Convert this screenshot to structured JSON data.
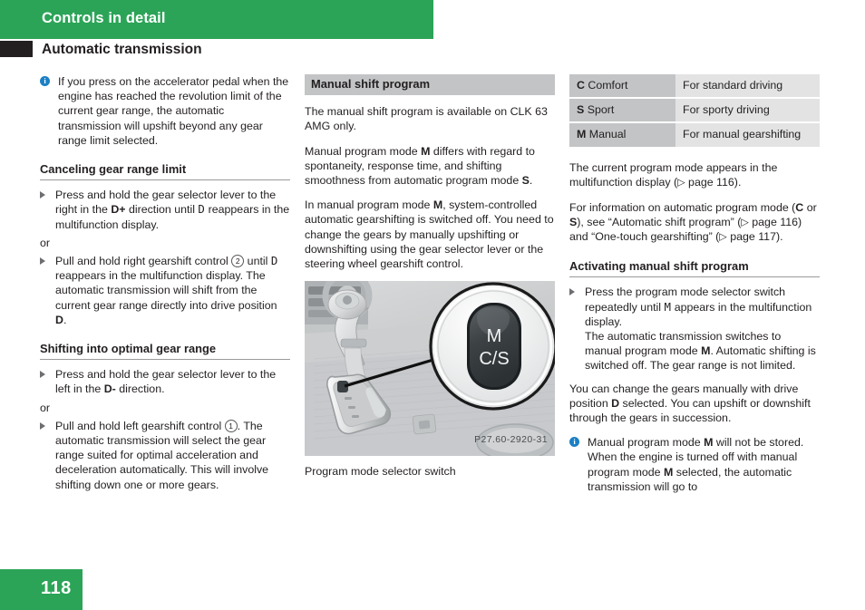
{
  "header": {
    "chapter_title": "Controls in detail",
    "section_title": "Automatic transmission",
    "bar_color": "#2ba457",
    "tab_color": "#231f20"
  },
  "footer": {
    "page_number": "118",
    "block_color": "#2ba457"
  },
  "left_column": {
    "note_icon": "info-icon",
    "note_text": "If you press on the accelerator pedal when the engine has reached the revolution limit of the current gear range, the automatic transmission will upshift beyond any gear range limit selected.",
    "heading_1": "Canceling gear range limit",
    "step_1_a": "Press and hold the gear selector lever to the right in the ",
    "step_1_a_bold": "D+",
    "step_1_a_cont": " direction until ",
    "step_1_a_glyph": "D",
    "step_1_a_end": " reappears in the multifunction display.",
    "or_label": "or",
    "step_1_b_start": "Pull and hold right gearshift control ",
    "step_1_b_callout": "2",
    "step_1_b_mid": " until ",
    "step_1_b_glyph": "D",
    "step_1_b_end": " reappears in the multifunction display. The automatic transmission will shift from the current gear range directly into drive position ",
    "step_1_b_bold": "D",
    "step_1_b_period": ".",
    "heading_2": "Shifting into optimal gear range",
    "step_2_a": "Press and hold the gear selector lever to the left in the ",
    "step_2_a_bold": "D-",
    "step_2_a_end": " direction.",
    "or_label_2": "or",
    "step_2_b_start": "Pull and hold left gearshift control ",
    "step_2_b_callout": "1",
    "step_2_b_end": ". The automatic transmission will select the gear range suited for optimal acceleration and deceleration automatically. This will involve shifting down one or more gears."
  },
  "middle_column": {
    "band_heading": "Manual shift program",
    "para_1": "The manual shift program is available on CLK 63 AMG only.",
    "para_2_a": "Manual program mode ",
    "para_2_bold_1": "M",
    "para_2_b": " differs with regard to spontaneity, response time, and shifting smoothness from automatic program mode ",
    "para_2_bold_2": "S",
    "para_2_c": ".",
    "para_3_a": "In manual program mode ",
    "para_3_bold": "M",
    "para_3_b": ", system-controlled automatic gearshifting is switched off. You need to change the gears by manually upshifting or downshifting using the gear selector lever or the steering wheel gearshift control.",
    "figure_name": "program-mode-selector-switch-photo",
    "figure_button_label_1": "M",
    "figure_button_label_2": "C/S",
    "figure_code": "P27.60-2920-31",
    "figure_caption": "Program mode selector switch"
  },
  "right_column": {
    "table": {
      "rows": [
        {
          "key_bold": "C",
          "key_text": " Comfort",
          "value": "For standard driving"
        },
        {
          "key_bold": "S",
          "key_text": " Sport",
          "value": "For sporty driving"
        },
        {
          "key_bold": "M",
          "key_text": " Manual",
          "value": "For manual gearshifting"
        }
      ]
    },
    "para_1_a": "The current program mode appears in the multifunction display (",
    "para_1_ref": "▷",
    "para_1_b": " page 116).",
    "para_2_a": "For information on automatic program mode (",
    "para_2_bold_1": "C",
    "para_2_b": " or ",
    "para_2_bold_2": "S",
    "para_2_c": "), see “Automatic shift program” (",
    "para_2_ref_1": "▷",
    "para_2_d": " page 116) and “One-touch gearshifting” (",
    "para_2_ref_2": "▷",
    "para_2_e": " page 117).",
    "heading": "Activating manual shift program",
    "step_a": "Press the program mode selector switch repeatedly until ",
    "step_a_glyph": "M",
    "step_a_cont": " appears in the multifunction display.",
    "step_a_line2_a": "The automatic transmission switches to manual program mode ",
    "step_a_bold": "M",
    "step_a_line2_b": ". Automatic shifting is switched off. The gear range is not limited.",
    "para_3_a": "You can change the gears manually with drive position ",
    "para_3_bold": "D",
    "para_3_b": " selected. You can upshift or downshift through the gears in succession.",
    "note_icon": "info-icon",
    "note_a": "Manual program mode ",
    "note_bold_1": "M",
    "note_b": " will not be stored. When the engine is turned off with manual program mode ",
    "note_bold_2": "M",
    "note_c": " selected, the automatic transmission will go to"
  }
}
